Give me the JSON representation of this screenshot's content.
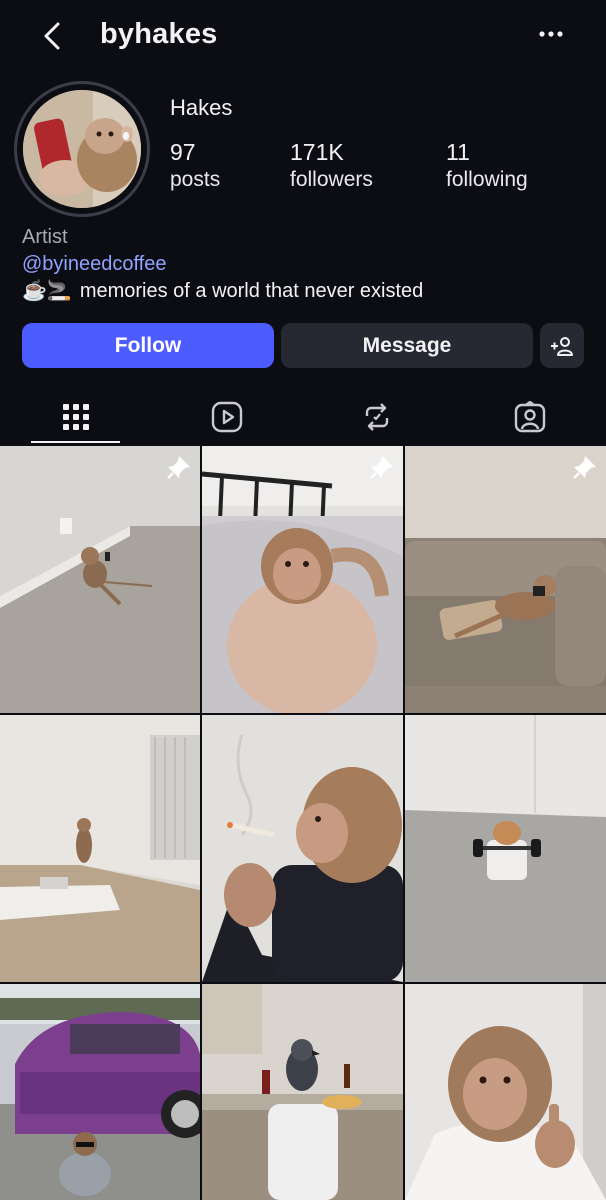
{
  "header": {
    "username": "byhakes",
    "back_icon": "chevron-left-icon",
    "more_icon": "more-horizontal-icon"
  },
  "profile": {
    "display_name": "Hakes",
    "stats": {
      "posts": {
        "value": "97",
        "label": "posts"
      },
      "followers": {
        "value": "171K",
        "label": "followers"
      },
      "following": {
        "value": "11",
        "label": "following"
      }
    },
    "bio": {
      "category": "Artist",
      "mention": "@byineedcoffee",
      "emojis": "☕🚬",
      "text": "memories of a world that never existed"
    }
  },
  "actions": {
    "follow": "Follow",
    "message": "Message",
    "suggest_icon": "add-person-icon"
  },
  "tabs": [
    {
      "name": "grid",
      "icon": "grid-icon",
      "active": true
    },
    {
      "name": "reels",
      "icon": "reels-icon",
      "active": false
    },
    {
      "name": "reposts",
      "icon": "repost-icon",
      "active": false
    },
    {
      "name": "tagged",
      "icon": "tagged-person-icon",
      "active": false
    }
  ],
  "posts": [
    {
      "subject": "monkey sitting against wall on floor",
      "pinned": true
    },
    {
      "subject": "monkey lying in bed",
      "pinned": true
    },
    {
      "subject": "monkey on couch with phone",
      "pinned": true
    },
    {
      "subject": "monkey in empty room with mattress",
      "pinned": false
    },
    {
      "subject": "monkey smoking cigarette",
      "pinned": false
    },
    {
      "subject": "hamster lifting dumbbell",
      "pinned": false
    },
    {
      "subject": "monkey squatting by purple car",
      "pinned": false
    },
    {
      "subject": "pigeon eating pizza in kitchen",
      "pinned": false
    },
    {
      "subject": "monkey selfie with middle finger",
      "pinned": false
    }
  ],
  "colors": {
    "background": "#0c0d12",
    "accent": "#4d5cff",
    "link": "#8fa3ff",
    "secondary_button": "#262932"
  }
}
